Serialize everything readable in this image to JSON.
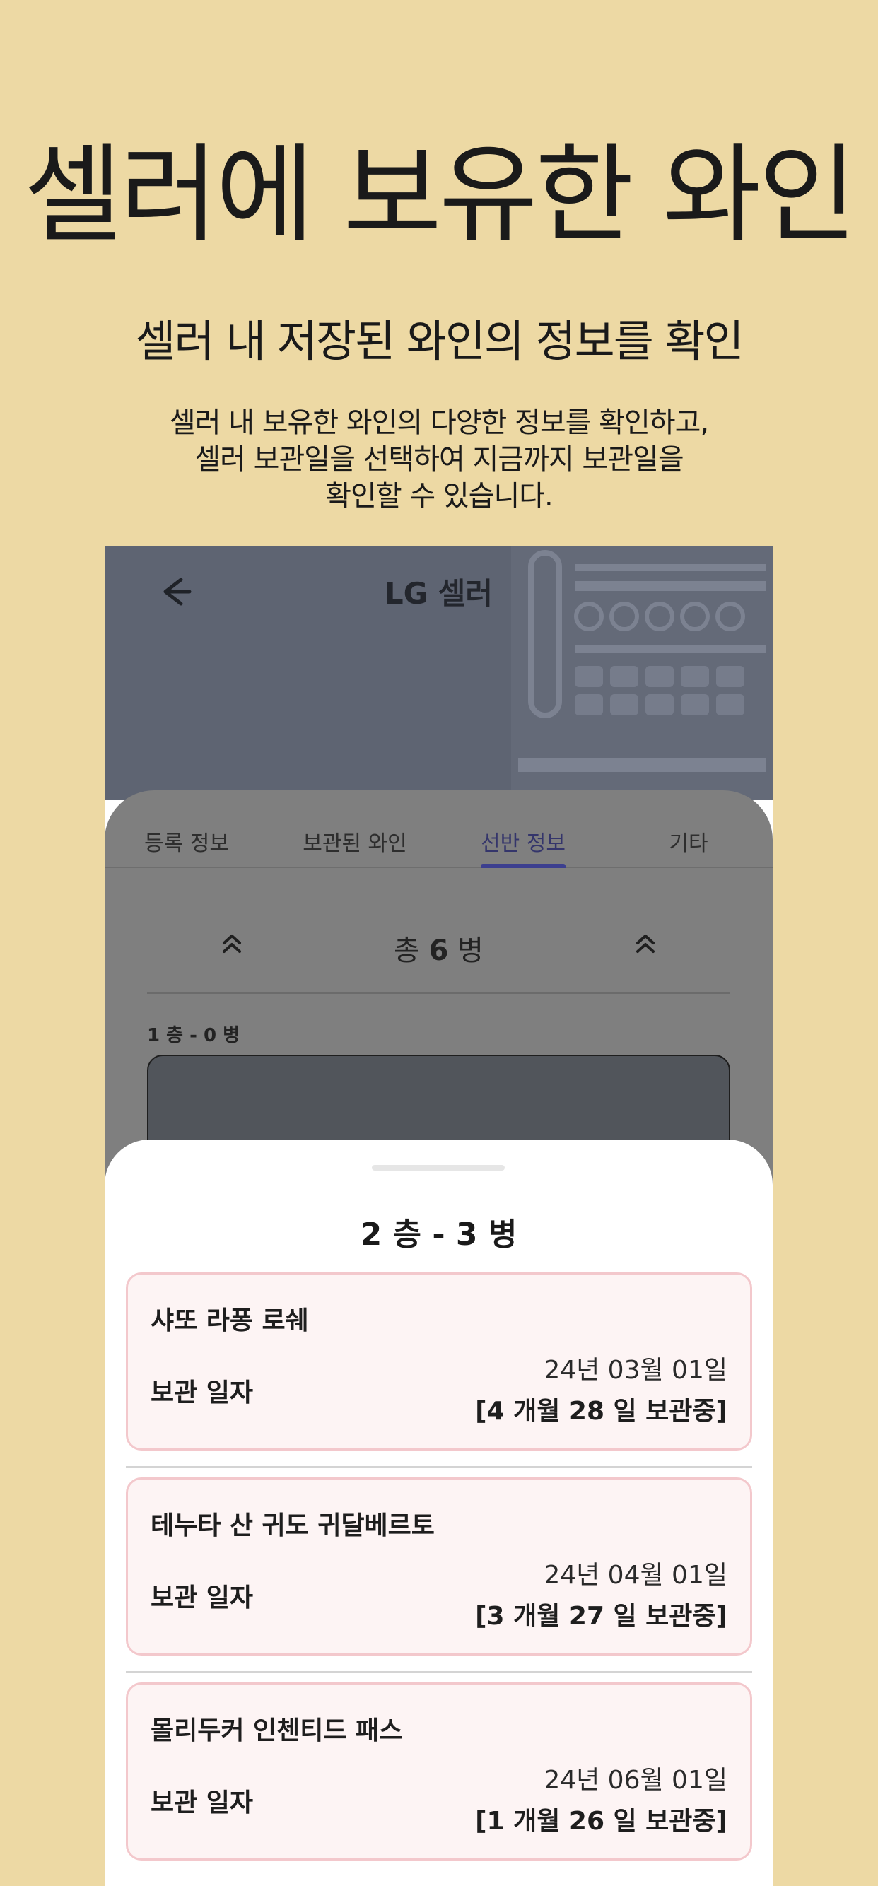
{
  "hero": {
    "title": "셀러에 보유한 와인",
    "subtitle": "셀러 내 저장된 와인의 정보를 확인",
    "description": "셀러 내 보유한 와인의  다양한 정보를 확인하고,\n셀러 보관일을 선택하여 지금까지 보관일을\n확인할 수 있습니다."
  },
  "app": {
    "title": "LG 셀러",
    "tabs": [
      {
        "label": "등록 정보"
      },
      {
        "label": "보관된 와인"
      },
      {
        "label": "선반 정보",
        "active": true
      },
      {
        "label": "기타"
      }
    ],
    "shelf_nav": {
      "total_prefix": "총",
      "total_count": "6",
      "total_suffix": "병"
    },
    "floor_label": "1 층 - 0 병"
  },
  "sheet": {
    "title": "2 층 - 3 병",
    "storage_label": "보관 일자",
    "wines": [
      {
        "name": "샤또 라퐁 로쉐",
        "date": "24년 03월 01일",
        "period": "[4 개월 28 일 보관중]"
      },
      {
        "name": "테누타 산 귀도 귀달베르토",
        "date": "24년 04월 01일",
        "period": "[3 개월 27 일 보관중]"
      },
      {
        "name": "몰리두커 인첸티드 패스",
        "date": "24년 06월 01일",
        "period": "[1 개월 26 일 보관중]"
      }
    ]
  },
  "colors": {
    "background": "#EDD9A4",
    "header": "#5E6472",
    "active_tab": "#3C3F8F",
    "card_bg": "#FDF4F4",
    "card_border": "#F3C8CC"
  },
  "icons": {
    "back": "arrow-left-icon",
    "shelf_up": "double-chevron-up-icon"
  }
}
